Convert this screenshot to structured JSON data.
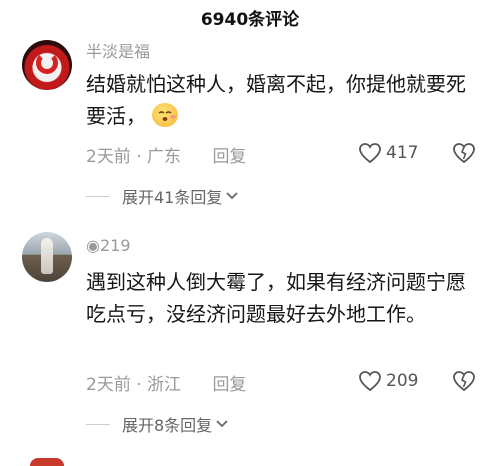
{
  "header": {
    "title": "6940条评论"
  },
  "comments": [
    {
      "username": "半淡是福",
      "text": "结婚就怕这种人，婚离不起，你提他就要死要活，",
      "time_location": "2天前 · 广东",
      "reply_label": "回复",
      "likes": "417",
      "expand_label": "展开41条回复",
      "emoji": "sleepy-face-emoji"
    },
    {
      "username": "◉219",
      "text": "遇到这种人倒大霉了，如果有经济问题宁愿吃点亏，没经济问题最好去外地工作。",
      "time_location": "2天前 · 浙江",
      "reply_label": "回复",
      "likes": "209",
      "expand_label": "展开8条回复"
    }
  ]
}
